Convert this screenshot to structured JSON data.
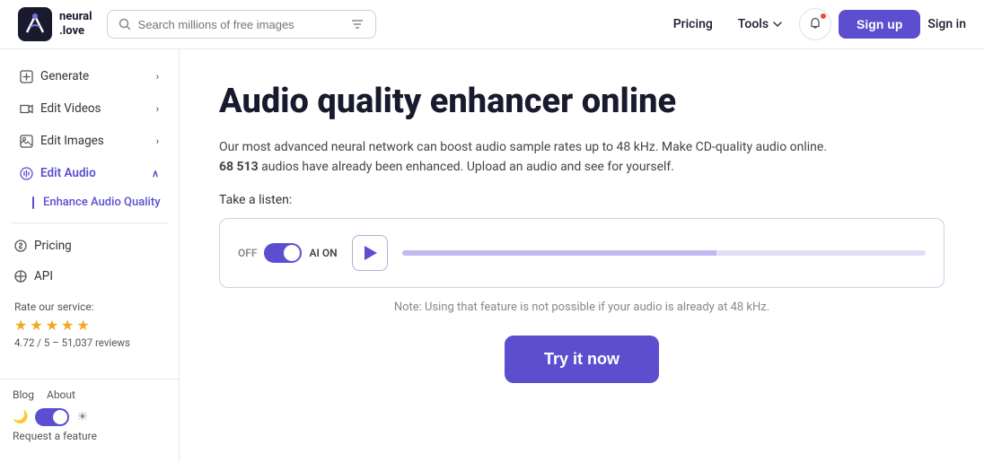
{
  "nav": {
    "logo_text_line1": "neural",
    "logo_text_line2": ".love",
    "search_placeholder": "Search millions of free images",
    "pricing_label": "Pricing",
    "tools_label": "Tools",
    "signup_label": "Sign up",
    "signin_label": "Sign in"
  },
  "sidebar": {
    "generate_label": "Generate",
    "edit_videos_label": "Edit Videos",
    "edit_images_label": "Edit Images",
    "edit_audio_label": "Edit Audio",
    "enhance_audio_label": "Enhance Audio Quality",
    "pricing_label": "Pricing",
    "api_label": "API",
    "rate_label": "Rate our service:",
    "stars": [
      "★",
      "★",
      "★",
      "★",
      "★"
    ],
    "rating_text": "4.72 / 5 – 51,037 reviews",
    "blog_label": "Blog",
    "about_label": "About",
    "request_label": "Request a feature"
  },
  "main": {
    "title": "Audio quality enhancer online",
    "description_line1": "Our most advanced neural network can boost audio sample rates up to 48 kHz. Make CD-quality audio online.",
    "description_bold": "68 513",
    "description_line2": " audios have already been enhanced. Upload an audio and see for yourself.",
    "take_listen": "Take a listen:",
    "off_label": "OFF",
    "ai_on_label": "AI ON",
    "note_text": "Note: Using that feature is not possible if your audio is already at 48 kHz.",
    "try_button_label": "Try it now"
  }
}
